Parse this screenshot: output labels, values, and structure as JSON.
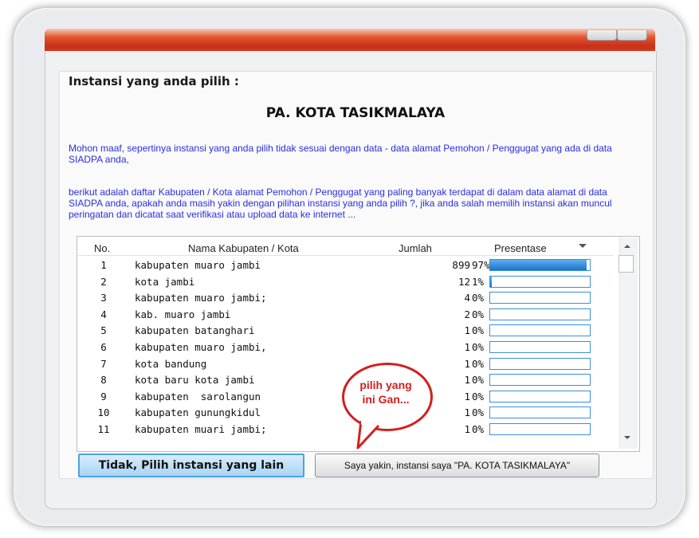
{
  "heading": "Instansi yang anda pilih :",
  "institusi": "PA. KOTA TASIKMALAYA",
  "message1": "Mohon maaf, sepertinya instansi yang anda pilih tidak sesuai dengan data - data alamat Pemohon / Penggugat yang ada di data SIADPA anda,",
  "message2": "berikut adalah daftar Kabupaten / Kota alamat Pemohon / Penggugat yang paling banyak terdapat di dalam data alamat di data SIADPA anda, apakah anda masih yakin dengan pilihan instansi yang anda pilih ?, jika anda salah memilih instansi akan muncul peringatan dan dicatat saat verifikasi atau upload data ke internet ...",
  "table": {
    "columns": {
      "no": "No.",
      "nama": "Nama Kabupaten / Kota",
      "jumlah": "Jumlah",
      "presentase": "Presentase"
    },
    "rows": [
      {
        "no": "1",
        "nama": "kabupaten muaro jambi",
        "jumlah": "899",
        "pct": "97%",
        "fill": 0.97
      },
      {
        "no": "2",
        "nama": "kota jambi",
        "jumlah": "12",
        "pct": "1%",
        "fill": 0.01
      },
      {
        "no": "3",
        "nama": "kabupaten muaro jambi;",
        "jumlah": "4",
        "pct": "0%",
        "fill": 0
      },
      {
        "no": "4",
        "nama": "kab. muaro jambi",
        "jumlah": "2",
        "pct": "0%",
        "fill": 0
      },
      {
        "no": "5",
        "nama": "kabupaten batanghari",
        "jumlah": "1",
        "pct": "0%",
        "fill": 0
      },
      {
        "no": "6",
        "nama": "kabupaten muaro jambi,",
        "jumlah": "1",
        "pct": "0%",
        "fill": 0
      },
      {
        "no": "7",
        "nama": "kota bandung",
        "jumlah": "1",
        "pct": "0%",
        "fill": 0
      },
      {
        "no": "8",
        "nama": "kota baru kota jambi",
        "jumlah": "1",
        "pct": "0%",
        "fill": 0
      },
      {
        "no": "9",
        "nama": "kabupaten  sarolangun",
        "jumlah": "1",
        "pct": "0%",
        "fill": 0
      },
      {
        "no": "10",
        "nama": "kabupaten gunungkidul",
        "jumlah": "1",
        "pct": "0%",
        "fill": 0
      },
      {
        "no": "11",
        "nama": "kabupaten muari jambi;",
        "jumlah": "1",
        "pct": "0%",
        "fill": 0
      }
    ]
  },
  "buttons": {
    "tidak": "Tidak, Pilih instansi yang lain",
    "yakin": "Saya yakin, instansi saya \"PA. KOTA TASIKMALAYA\""
  },
  "callout": "pilih yang\nini Gan...",
  "colors": {
    "accent": "#2a2ee0",
    "callout": "#d0201e",
    "progress": "#1f72c8",
    "titlebar": "#c8301a"
  }
}
